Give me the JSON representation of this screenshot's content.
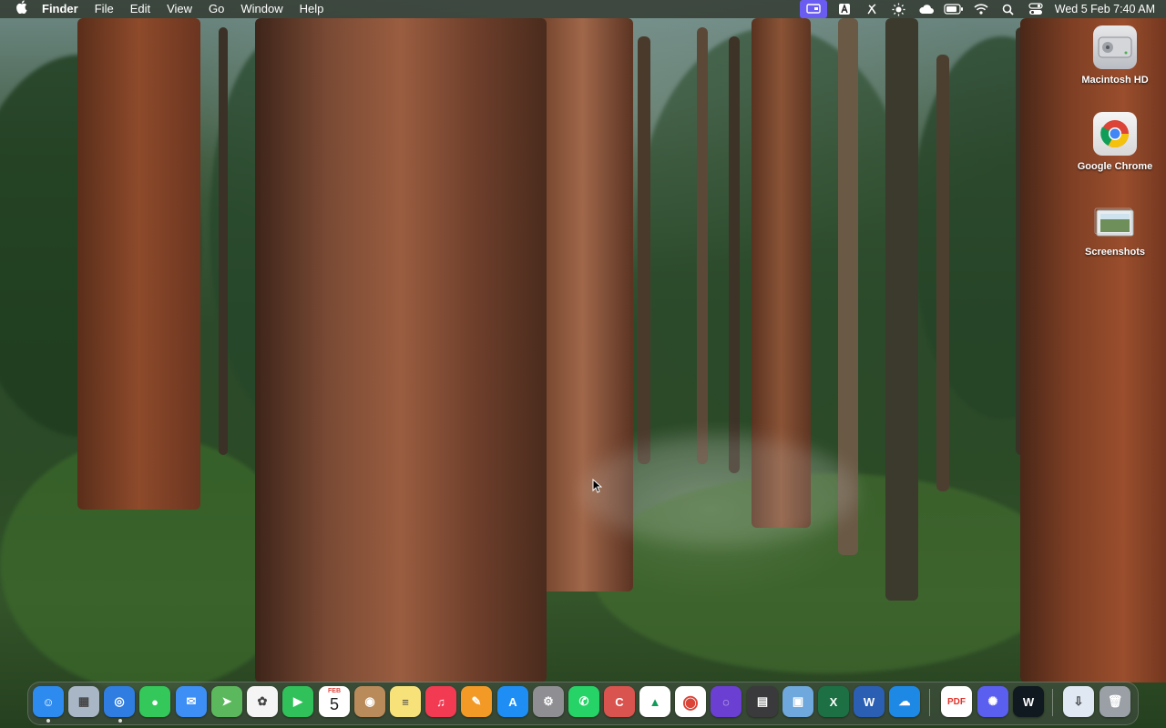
{
  "menubar": {
    "apple": "",
    "app_name": "Finder",
    "menus": [
      "File",
      "Edit",
      "View",
      "Go",
      "Window",
      "Help"
    ],
    "status_icons": [
      "screen-mirroring-icon",
      "text-input-icon",
      "script-icon",
      "brightness-icon",
      "cloud-icon",
      "battery-icon",
      "wifi-icon",
      "search-icon",
      "control-center-icon"
    ],
    "clock": "Wed 5 Feb  7:40 AM"
  },
  "desktop": {
    "icons": [
      {
        "label": "Macintosh HD",
        "icon": "hard-drive-icon"
      },
      {
        "label": "Google Chrome",
        "icon": "chrome-icon"
      },
      {
        "label": "Screenshots",
        "icon": "folder-icon"
      }
    ]
  },
  "calendar_icon": {
    "month": "FEB",
    "day": "5"
  },
  "dock": {
    "apps": [
      {
        "name": "finder",
        "color": "#2d8bf0",
        "glyph": "☺"
      },
      {
        "name": "launchpad",
        "color": "#a9b6c6",
        "glyph": "▦"
      },
      {
        "name": "safari",
        "color": "#2f7de1",
        "glyph": "◎"
      },
      {
        "name": "messages",
        "color": "#34c759",
        "glyph": "●"
      },
      {
        "name": "mail",
        "color": "#3d8ef5",
        "glyph": "✉"
      },
      {
        "name": "maps",
        "color": "#5cb85c",
        "glyph": "➤"
      },
      {
        "name": "photos",
        "color": "#f5f5f5",
        "glyph": "✿"
      },
      {
        "name": "facetime",
        "color": "#30c15a",
        "glyph": "▶"
      },
      {
        "name": "calendar",
        "color": "#ffffff",
        "glyph": ""
      },
      {
        "name": "contacts",
        "color": "#b98a5a",
        "glyph": "◉"
      },
      {
        "name": "notes",
        "color": "#f7e27a",
        "glyph": "≡"
      },
      {
        "name": "music",
        "color": "#f23a52",
        "glyph": "♫"
      },
      {
        "name": "pages",
        "color": "#f39a26",
        "glyph": "✎"
      },
      {
        "name": "app-store",
        "color": "#1e8ef5",
        "glyph": "A"
      },
      {
        "name": "system-settings",
        "color": "#8e8e93",
        "glyph": "⚙"
      },
      {
        "name": "whatsapp",
        "color": "#25d366",
        "glyph": "✆"
      },
      {
        "name": "ccleaner",
        "color": "#d9534f",
        "glyph": "C"
      },
      {
        "name": "google-drive",
        "color": "#ffffff",
        "glyph": "▲"
      },
      {
        "name": "google-chrome",
        "color": "#ffffff",
        "glyph": "◉"
      },
      {
        "name": "podcasts-like",
        "color": "#6a3fd1",
        "glyph": "◌"
      },
      {
        "name": "calculator",
        "color": "#3a3a3c",
        "glyph": "▤"
      },
      {
        "name": "preview",
        "color": "#6fa8dc",
        "glyph": "▣"
      },
      {
        "name": "excel",
        "color": "#1d7044",
        "glyph": "X"
      },
      {
        "name": "word",
        "color": "#2b5fb4",
        "glyph": "W"
      },
      {
        "name": "onedrive",
        "color": "#1e88e5",
        "glyph": "☁"
      },
      {
        "name": "pdf-reader",
        "color": "#ffffff",
        "glyph": "PDF"
      },
      {
        "name": "perplexity-like",
        "color": "#5b5ff0",
        "glyph": "✺"
      },
      {
        "name": "webex-like",
        "color": "#101820",
        "glyph": "W"
      },
      {
        "name": "downloads-stack",
        "color": "#dfe8f3",
        "glyph": "⇩"
      },
      {
        "name": "trash",
        "color": "#9aa0a6",
        "glyph": "🗑"
      }
    ]
  }
}
